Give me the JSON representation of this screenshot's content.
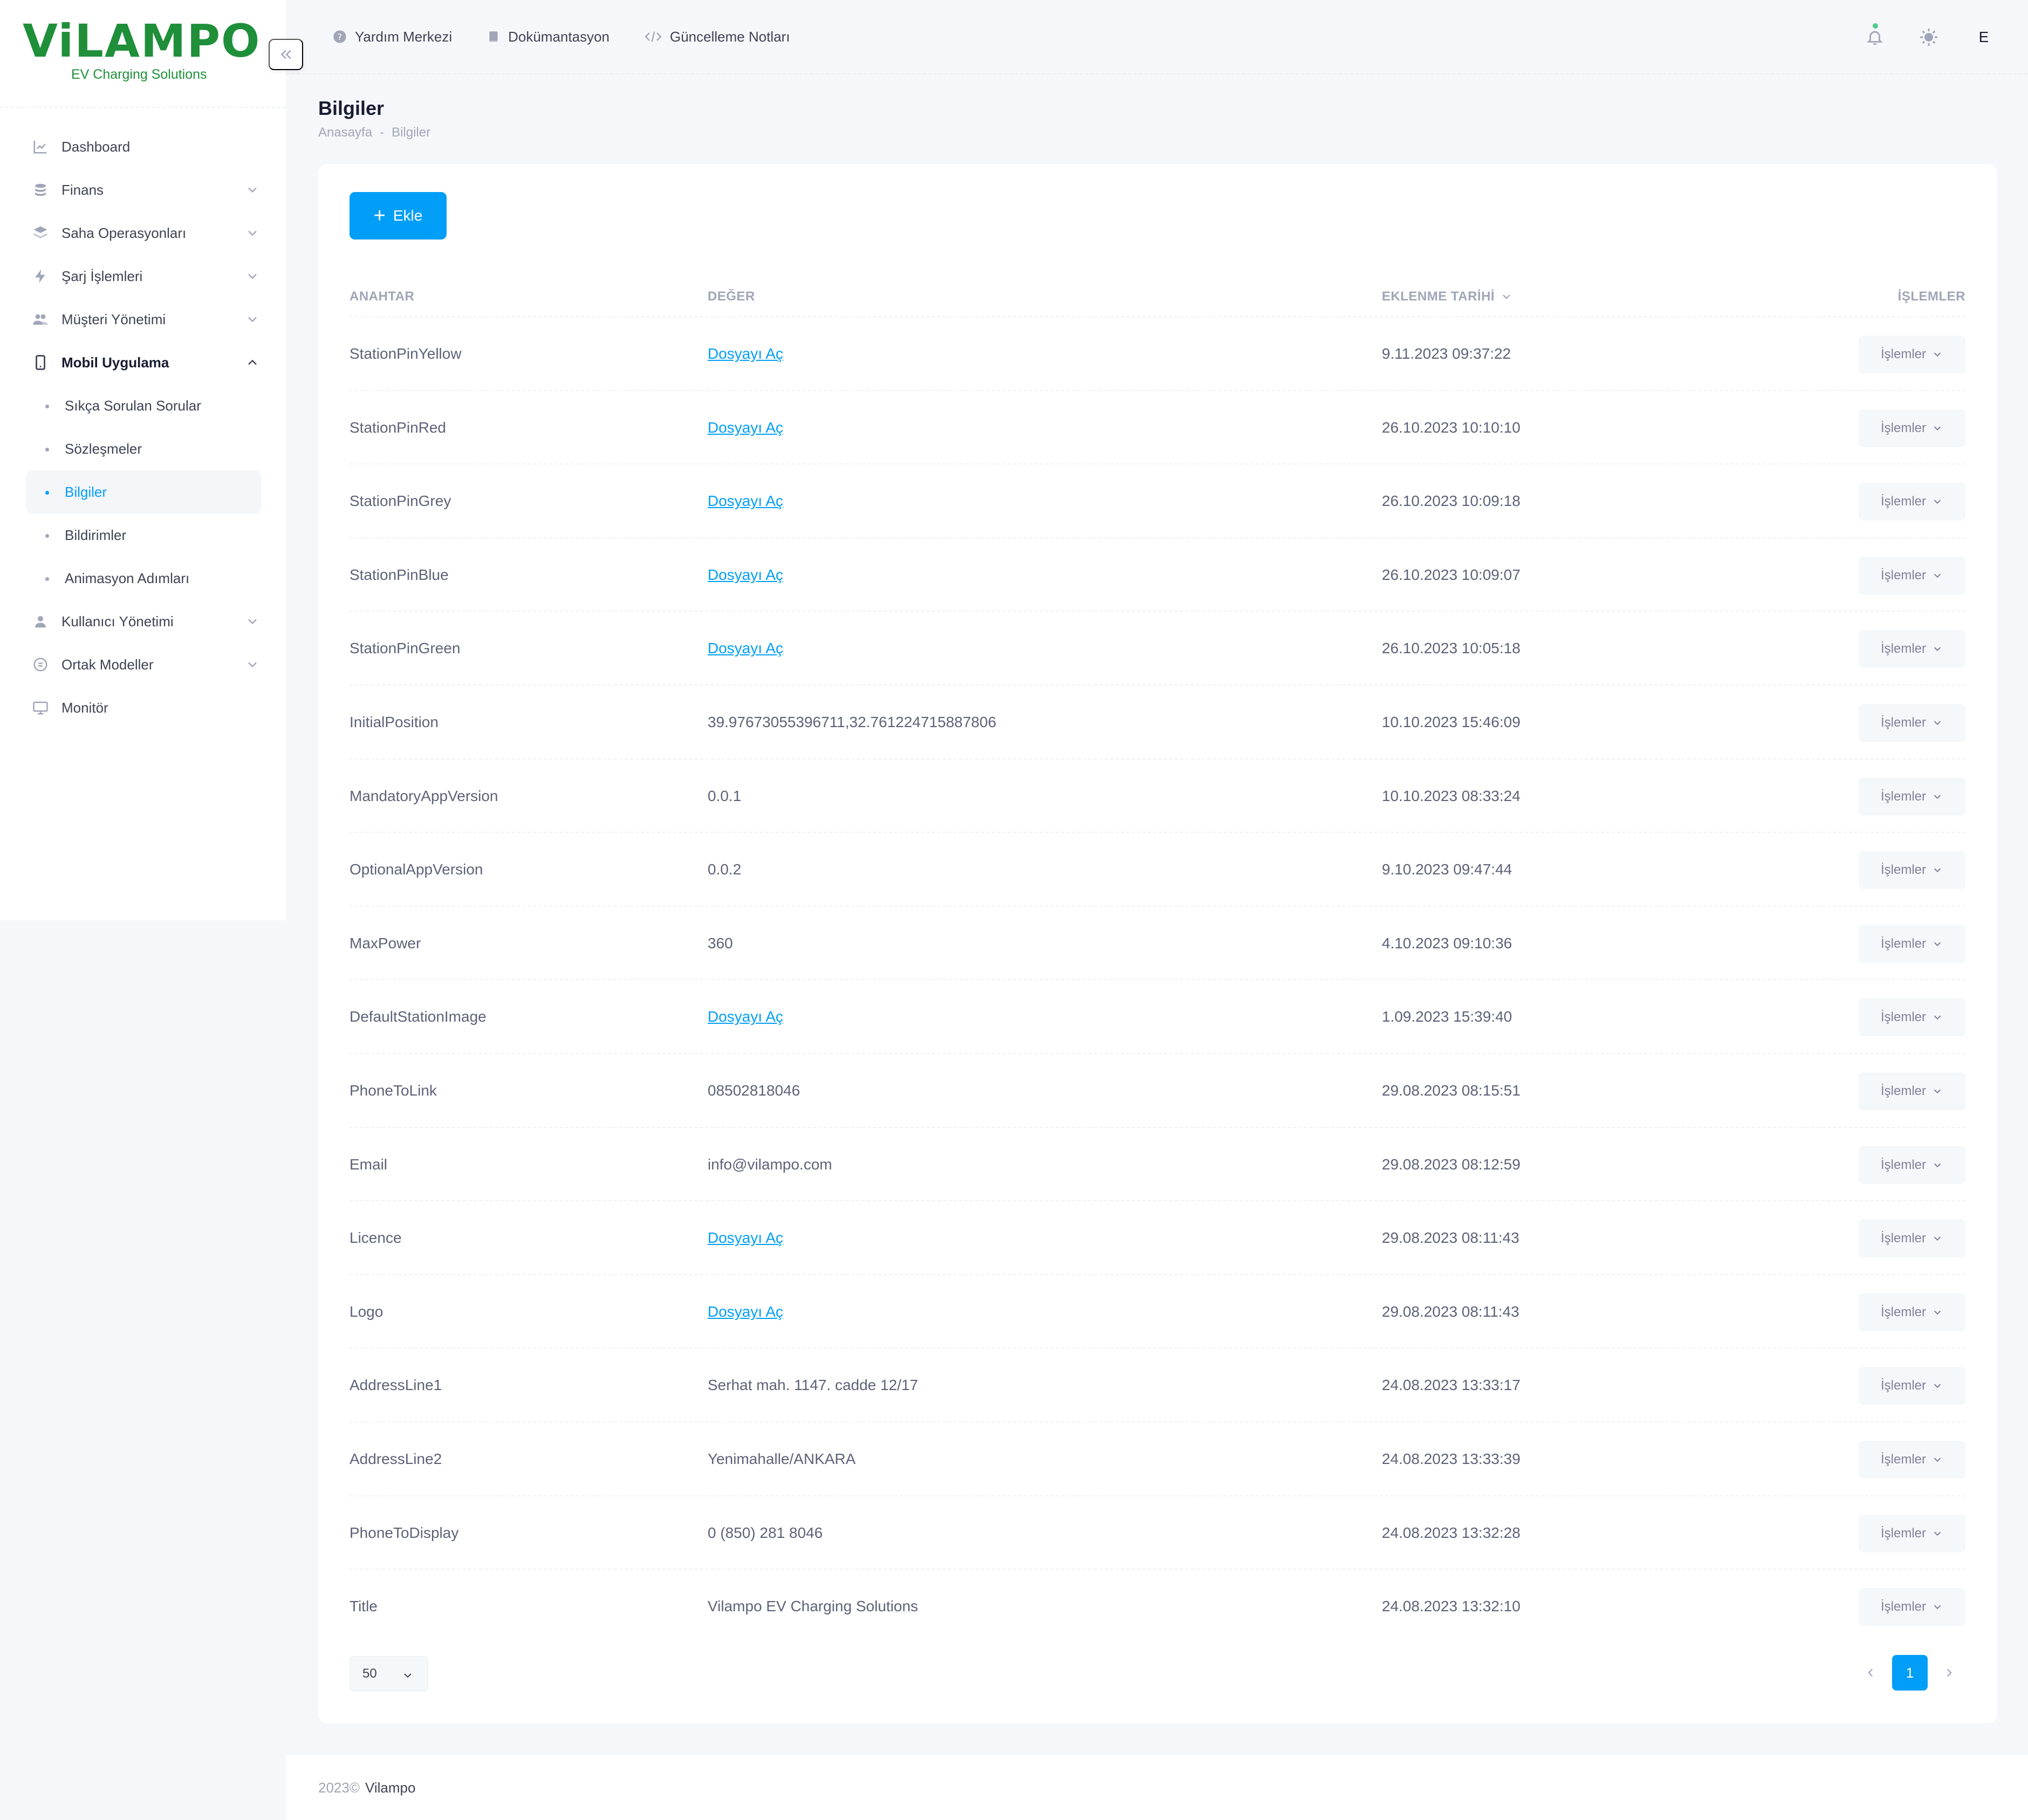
{
  "brand": {
    "logo_text": "ViLAMPO",
    "tagline": "EV Charging Solutions"
  },
  "colors": {
    "primary": "#009ef7",
    "logo_green": "#1f8f3a",
    "text": "#3f4254",
    "muted": "#a1a5b7"
  },
  "sidebar": {
    "items": [
      {
        "label": "Dashboard",
        "icon": "chart-line-icon"
      },
      {
        "label": "Finans",
        "icon": "coins-icon"
      },
      {
        "label": "Saha Operasyonları",
        "icon": "layers-icon"
      },
      {
        "label": "Şarj İşlemleri",
        "icon": "bolt-icon"
      },
      {
        "label": "Müşteri Yönetimi",
        "icon": "users-icon"
      },
      {
        "label": "Mobil Uygulama",
        "icon": "phone-icon"
      },
      {
        "label": "Kullanıcı Yönetimi",
        "icon": "user-icon"
      },
      {
        "label": "Ortak Modeller",
        "icon": "circle-icon"
      },
      {
        "label": "Monitör",
        "icon": "monitor-icon"
      }
    ],
    "sub_items": [
      {
        "label": "Sıkça Sorulan Sorular"
      },
      {
        "label": "Sözleşmeler"
      },
      {
        "label": "Bilgiler"
      },
      {
        "label": "Bildirimler"
      },
      {
        "label": "Animasyon Adımları"
      }
    ]
  },
  "header": {
    "links": [
      {
        "label": "Yardım Merkezi",
        "icon": "help-circle-icon"
      },
      {
        "label": "Dokümantasyon",
        "icon": "book-icon"
      },
      {
        "label": "Güncelleme Notları",
        "icon": "code-icon"
      }
    ],
    "avatar_letter": "E"
  },
  "page": {
    "title": "Bilgiler",
    "breadcrumb": [
      "Anasayfa",
      "-",
      "Bilgiler"
    ]
  },
  "toolbar": {
    "add_label": "Ekle"
  },
  "table": {
    "columns": [
      "ANAHTAR",
      "DEĞER",
      "EKLENME TARİHİ",
      "İŞLEMLER"
    ],
    "action_label": "İşlemler",
    "rows": [
      {
        "key": "StationPinYellow",
        "value": "Dosyayı Aç",
        "is_link": true,
        "date": "9.11.2023 09:37:22"
      },
      {
        "key": "StationPinRed",
        "value": "Dosyayı Aç",
        "is_link": true,
        "date": "26.10.2023 10:10:10"
      },
      {
        "key": "StationPinGrey",
        "value": "Dosyayı Aç",
        "is_link": true,
        "date": "26.10.2023 10:09:18"
      },
      {
        "key": "StationPinBlue",
        "value": "Dosyayı Aç",
        "is_link": true,
        "date": "26.10.2023 10:09:07"
      },
      {
        "key": "StationPinGreen",
        "value": "Dosyayı Aç",
        "is_link": true,
        "date": "26.10.2023 10:05:18"
      },
      {
        "key": "InitialPosition",
        "value": "39.97673055396711,32.761224715887806",
        "is_link": false,
        "date": "10.10.2023 15:46:09"
      },
      {
        "key": "MandatoryAppVersion",
        "value": "0.0.1",
        "is_link": false,
        "date": "10.10.2023 08:33:24"
      },
      {
        "key": "OptionalAppVersion",
        "value": "0.0.2",
        "is_link": false,
        "date": "9.10.2023 09:47:44"
      },
      {
        "key": "MaxPower",
        "value": "360",
        "is_link": false,
        "date": "4.10.2023 09:10:36"
      },
      {
        "key": "DefaultStationImage",
        "value": "Dosyayı Aç",
        "is_link": true,
        "date": "1.09.2023 15:39:40"
      },
      {
        "key": "PhoneToLink",
        "value": "08502818046",
        "is_link": false,
        "date": "29.08.2023 08:15:51"
      },
      {
        "key": "Email",
        "value": "info@vilampo.com",
        "is_link": false,
        "date": "29.08.2023 08:12:59"
      },
      {
        "key": "Licence",
        "value": "Dosyayı Aç",
        "is_link": true,
        "date": "29.08.2023 08:11:43"
      },
      {
        "key": "Logo",
        "value": "Dosyayı Aç",
        "is_link": true,
        "date": "29.08.2023 08:11:43"
      },
      {
        "key": "AddressLine1",
        "value": "Serhat mah. 1147. cadde 12/17",
        "is_link": false,
        "date": "24.08.2023 13:33:17"
      },
      {
        "key": "AddressLine2",
        "value": "Yenimahalle/ANKARA",
        "is_link": false,
        "date": "24.08.2023 13:33:39"
      },
      {
        "key": "PhoneToDisplay",
        "value": "0 (850) 281 8046",
        "is_link": false,
        "date": "24.08.2023 13:32:28"
      },
      {
        "key": "Title",
        "value": "Vilampo EV Charging Solutions",
        "is_link": false,
        "date": "24.08.2023 13:32:10"
      }
    ]
  },
  "pagination": {
    "page_size": "50",
    "current_page": "1"
  },
  "footer": {
    "year": "2023©",
    "brand": "Vilampo"
  }
}
